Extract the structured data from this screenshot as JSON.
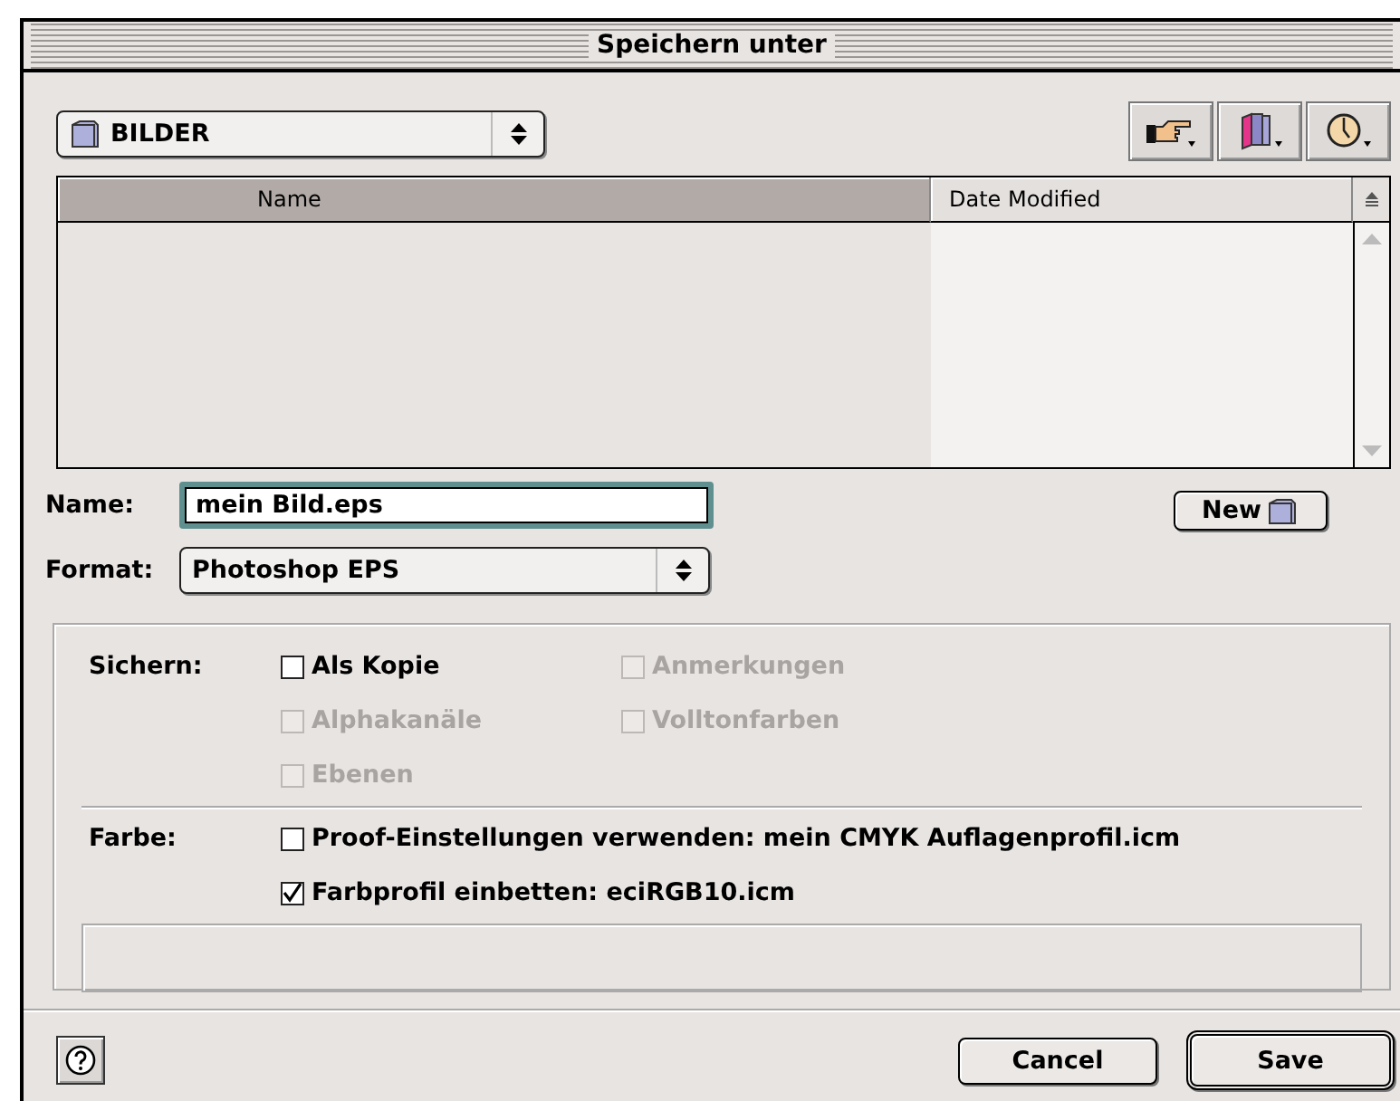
{
  "window": {
    "title": "Speichern unter"
  },
  "location": {
    "value": "BILDER"
  },
  "file_list": {
    "columns": [
      {
        "label": "Name",
        "selected": true
      },
      {
        "label": "Date Modified",
        "selected": false
      }
    ]
  },
  "name_field": {
    "label": "Name:",
    "value": "mein Bild.eps"
  },
  "new_button": {
    "label": "New"
  },
  "format": {
    "label": "Format:",
    "value": "Photoshop EPS"
  },
  "sections": [
    {
      "label": "Sichern:",
      "kind": "grid",
      "options": [
        {
          "label": "Als Kopie",
          "checked": false,
          "disabled": false
        },
        {
          "label": "Anmerkungen",
          "checked": false,
          "disabled": true
        },
        {
          "label": "Alphakanäle",
          "checked": false,
          "disabled": true
        },
        {
          "label": "Volltonfarben",
          "checked": false,
          "disabled": true
        },
        {
          "label": "Ebenen",
          "checked": false,
          "disabled": true
        }
      ]
    },
    {
      "label": "Farbe:",
      "kind": "list",
      "options": [
        {
          "label": "Proof-Einstellungen verwenden: mein CMYK Auflagenprofil.icm",
          "checked": false,
          "disabled": false
        },
        {
          "label": "Farbprofil einbetten: eciRGB10.icm",
          "checked": true,
          "disabled": false
        }
      ]
    }
  ],
  "buttons": [
    {
      "label": "Cancel",
      "default": false
    },
    {
      "label": "Save",
      "default": true
    }
  ]
}
